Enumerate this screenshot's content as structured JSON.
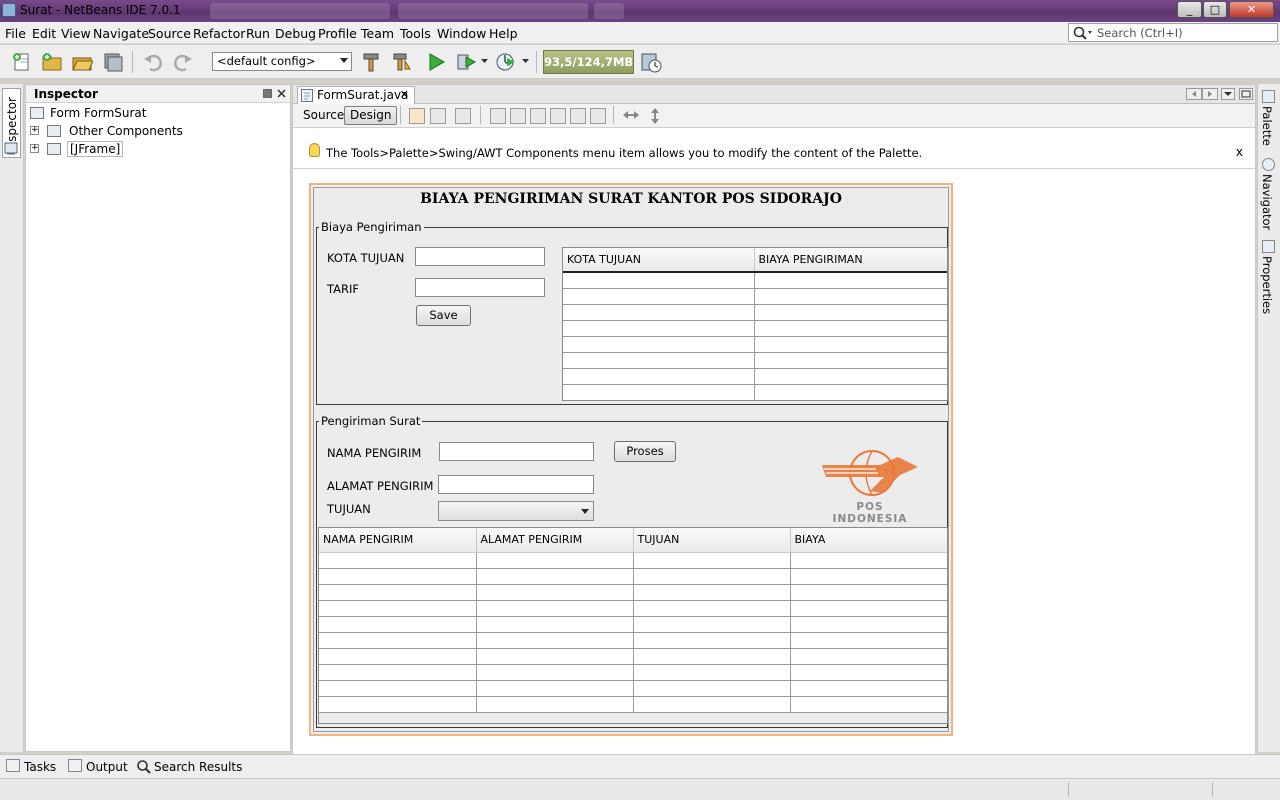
{
  "window": {
    "title": "Surat - NetBeans IDE 7.0.1",
    "controls": {
      "minimize": "_",
      "maximize": "□",
      "close": "✕"
    }
  },
  "menu": {
    "items": [
      {
        "label": "File"
      },
      {
        "label": "Edit"
      },
      {
        "label": "View"
      },
      {
        "label": "Navigate"
      },
      {
        "label": "Source"
      },
      {
        "label": "Refactor"
      },
      {
        "label": "Run"
      },
      {
        "label": "Debug"
      },
      {
        "label": "Profile"
      },
      {
        "label": "Team"
      },
      {
        "label": "Tools"
      },
      {
        "label": "Window"
      },
      {
        "label": "Help"
      }
    ],
    "search_placeholder": "Search (Ctrl+I)"
  },
  "toolbar": {
    "config": "<default config>",
    "memory": "93,5/124,7MB"
  },
  "inspector": {
    "title": "Inspector",
    "side_tab": "Inspector",
    "tree": [
      {
        "label": "Form FormSurat"
      },
      {
        "label": "Other Components"
      },
      {
        "label": "[JFrame]"
      }
    ]
  },
  "editor": {
    "file_tab": "FormSurat.java",
    "close_glyph": "✕",
    "view_source": "Source",
    "view_design": "Design",
    "hint": "The Tools>Palette>Swing/AWT Components menu item allows you to modify the content of the Palette.",
    "hint_close": "x"
  },
  "form": {
    "title": "BIAYA PENGIRIMAN SURAT KANTOR POS SIDORAJO",
    "biaya_group": {
      "legend": "Biaya Pengiriman",
      "kota_label": "KOTA TUJUAN",
      "tarif_label": "TARIF",
      "save_label": "Save",
      "table_headers": [
        "KOTA TUJUAN",
        "BIAYA PENGIRIMAN"
      ]
    },
    "pengiriman_group": {
      "legend": "Pengiriman Surat",
      "nama_label": "NAMA PENGIRIM",
      "alamat_label": "ALAMAT PENGIRIM",
      "tujuan_label": "TUJUAN",
      "proses_label": "Proses",
      "table_headers": [
        "NAMA PENGIRIM",
        "ALAMAT PENGIRIM",
        "TUJUAN",
        "BIAYA"
      ]
    },
    "logo_text": "POS INDONESIA",
    "brand_color": "#e8793a"
  },
  "right_panel": {
    "tabs": [
      {
        "label": "Palette"
      },
      {
        "label": "Navigator"
      },
      {
        "label": "Properties"
      }
    ]
  },
  "bottom": {
    "tabs": [
      {
        "label": "Tasks"
      },
      {
        "label": "Output"
      },
      {
        "label": "Search Results"
      }
    ]
  }
}
